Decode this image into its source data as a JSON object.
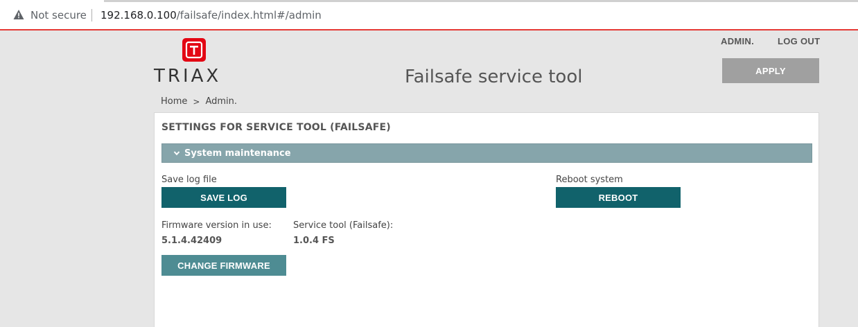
{
  "browser": {
    "security_label": "Not secure",
    "url_host": "192.168.0.100",
    "url_path": "/failsafe/index.html#/admin"
  },
  "header": {
    "logo_text": "TRIAX",
    "title": "Failsafe service tool",
    "nav": {
      "admin": "ADMIN.",
      "logout": "LOG OUT"
    },
    "apply_label": "APPLY"
  },
  "breadcrumb": {
    "home": "Home",
    "separator": ">",
    "current": "Admin."
  },
  "panel": {
    "title": "SETTINGS FOR SERVICE TOOL (FAILSAFE)",
    "section": "System maintenance",
    "save_log": {
      "label": "Save log file",
      "button": "SAVE LOG"
    },
    "reboot": {
      "label": "Reboot system",
      "button": "REBOOT"
    },
    "firmware": {
      "label": "Firmware version in use:",
      "value": "5.1.4.42409"
    },
    "service_tool": {
      "label": "Service tool (Failsafe):",
      "value": "1.0.4 FS"
    },
    "change_firmware": "CHANGE FIRMWARE"
  },
  "colors": {
    "brand_red": "#e30613",
    "teal_dark": "#11626b",
    "teal_light": "#4e8c93",
    "section_bar": "#86a5ab",
    "apply_disabled": "#a0a0a0"
  }
}
